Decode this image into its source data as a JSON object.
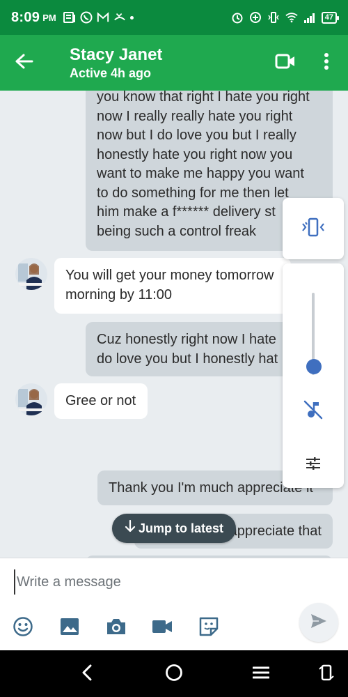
{
  "status_bar": {
    "time": "8:09",
    "ampm": "PM",
    "battery": "47"
  },
  "header": {
    "contact_name": "Stacy Janet",
    "contact_status": "Active 4h ago"
  },
  "messages": [
    {
      "direction": "out",
      "lines": [
        "you know that right I hate you right",
        "now I really really hate you right",
        "now but I do love you but I really",
        "honestly hate you right now you",
        "want to make me happy you want",
        "to do something for me then let",
        "him make a f****** delivery st",
        "being such a control freak"
      ]
    },
    {
      "direction": "in",
      "lines": [
        "You will get your money tomorrow",
        "morning by 11:00"
      ]
    },
    {
      "direction": "out",
      "lines": [
        "Cuz honestly right now I hate",
        "do love you but I honestly hat"
      ]
    },
    {
      "direction": "in",
      "lines": [
        "Gree or not"
      ]
    },
    {
      "direction": "out",
      "lines": [
        "Thank you I'm much appreciate it"
      ]
    },
    {
      "direction": "out",
      "lines": [
        "appreciate that"
      ]
    }
  ],
  "jump_button": {
    "label": "Jump to latest"
  },
  "volume_panel": {
    "level": 0.1
  },
  "compose": {
    "placeholder": "Write a message"
  },
  "icons": {
    "back": "arrow-left-icon",
    "video": "video-camera-icon",
    "more": "more-vert-icon",
    "emoji": "emoji-icon",
    "gallery": "image-icon",
    "camera": "camera-icon",
    "video_record": "video-icon",
    "sticker": "sticker-icon",
    "send": "send-icon"
  },
  "colors": {
    "status_bar": "#0b8a3e",
    "app_bar": "#1fa94f",
    "outgoing_bubble": "#cfd6db",
    "incoming_bubble": "#ffffff",
    "accent_blue": "#3f6fbf"
  }
}
